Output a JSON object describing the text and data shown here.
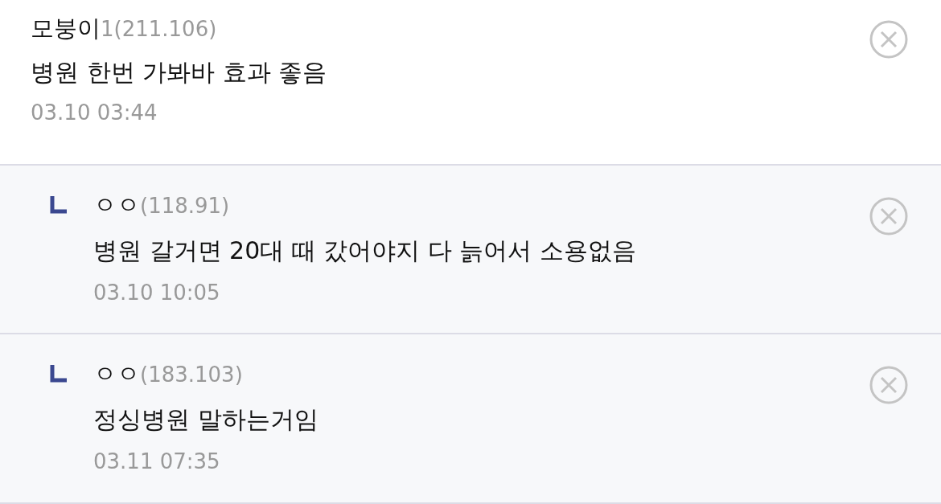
{
  "comments": [
    {
      "kind": "comment",
      "name": "모붕이",
      "ip": "1(211.106)",
      "text": "병원 한번 가봐바 효과 좋음",
      "date": "03.10 03:44"
    },
    {
      "kind": "reply",
      "name": "ㅇㅇ",
      "ip": "(118.91)",
      "text": "병원 갈거면 20대 때 갔어야지 다 늙어서 소용없음",
      "date": "03.10 10:05"
    },
    {
      "kind": "reply",
      "name": "ㅇㅇ",
      "ip": "(183.103)",
      "text": "정싱병원 말하는거임",
      "date": "03.11 07:35"
    }
  ]
}
